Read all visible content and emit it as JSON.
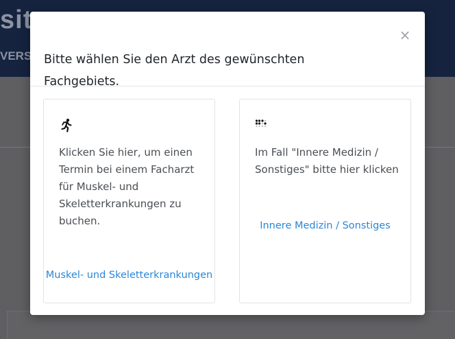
{
  "background": {
    "logo_text": "sit",
    "logo_sub": "VERS"
  },
  "modal": {
    "title": "Bitte wählen Sie den Arzt des gewünschten Fachgebiets.",
    "close_symbol": "×",
    "cards": [
      {
        "icon": "running-person-icon",
        "text": "Klicken Sie hier, um einen Termin bei einem Facharzt für Muskel- und Skeletterkrankungen zu buchen.",
        "link_label": "Muskel- und Skeletterkrankungen"
      },
      {
        "icon": "braille-dots-icon",
        "text": "Im Fall \"Innere Medizin / Sonstiges\" bitte hier klicken",
        "link_label": "Innere Medizin / Sonstiges"
      }
    ]
  },
  "colors": {
    "overlay": "#5f5f62",
    "header_dimmed": "#15233f",
    "link": "#2a86d6",
    "title_text": "#212529",
    "body_text": "#4a4e53"
  }
}
